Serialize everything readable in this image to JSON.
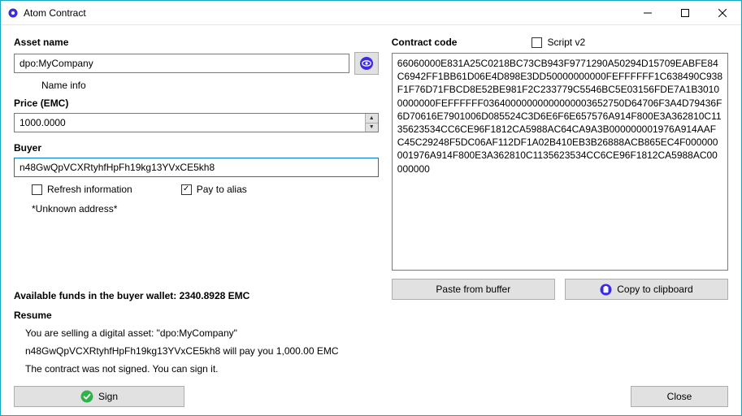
{
  "window": {
    "title": "Atom Contract"
  },
  "left": {
    "asset_name_label": "Asset name",
    "asset_name_value": "dpo:MyCompany",
    "name_info": "Name info",
    "price_label": "Price (EMC)",
    "price_value": "1000.0000",
    "buyer_label": "Buyer",
    "buyer_value": "n48GwQpVCXRtyhfHpFh19kg13YVxCE5kh8",
    "refresh_label": "Refresh information",
    "pay_alias_label": "Pay to alias",
    "pay_alias_checked": true,
    "unknown_address": "*Unknown address*",
    "funds_line": "Available funds in the buyer wallet: 2340.8928 EMC",
    "resume_head": "Resume",
    "resume_line1": "You are selling a digital asset: \"dpo:MyCompany\"",
    "resume_line2": "n48GwQpVCXRtyhfHpFh19kg13YVxCE5kh8 will pay you 1,000.00 EMC",
    "resume_line3": "The contract was not signed. You can sign it.",
    "sign_label": "Sign"
  },
  "right": {
    "contract_code_label": "Contract code",
    "script_v2_label": "Script v2",
    "code": "66060000E831A25C0218BC73CB943F9771290A50294D15709EABFE84C6942FF1BB61D06E4D898E3DD50000000000FEFFFFFF1C638490C938F1F76D71FBCD8E52BE981F2C233779C5546BC5E03156FDE7A1B30100000000FEFFFFFF03640000000000000003652750D64706F3A4D79436F6D70616E7901006D085524C3D6E6F6E657576A914F800E3A362810C1135623534CC6CE96F1812CA5988AC64CA9A3B000000001976A914AAFC45C29248F5DC06AF112DF1A02B410EB3B26888ACB865EC4F000000001976A914F800E3A362810C1135623534CC6CE96F1812CA5988AC00000000",
    "paste_label": "Paste from buffer",
    "copy_label": "Copy to clipboard",
    "close_label": "Close"
  }
}
